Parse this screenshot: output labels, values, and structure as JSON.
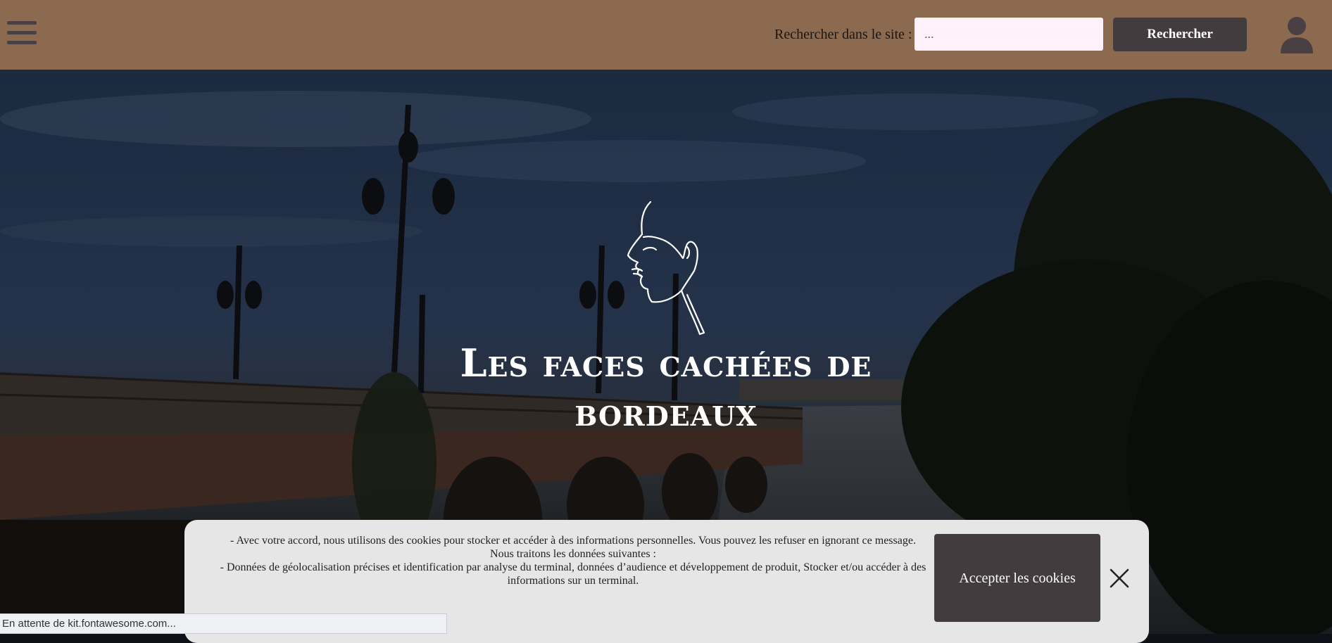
{
  "header": {
    "menu_icon": "hamburger-icon",
    "search_label": "Rechercher dans le site :",
    "search_placeholder": "...",
    "search_button": "Rechercher",
    "user_icon": "user-icon",
    "background_color": "#8b6a4f"
  },
  "hero": {
    "logo_icon": "face-line-art-icon",
    "title_line1": "Les faces cachées de",
    "title_line2": "bordeaux"
  },
  "cookie_banner": {
    "line1": "- Avec votre accord, nous utilisons des cookies pour stocker et accéder à des informations personnelles. Vous pouvez les refuser en ignorant ce message.",
    "line2": "Nous traitons les données suivantes :",
    "line3": "- Données de géolocalisation précises et identification par analyse du terminal, données d’audience et développement de produit, Stocker et/ou accéder à des",
    "line4": "informations sur un terminal.",
    "accept_button": "Accepter les cookies",
    "close_icon": "close-icon"
  },
  "status_bar": {
    "text": "En attente de kit.fontawesome.com..."
  },
  "colors": {
    "button_dark": "#433c3e",
    "search_field": "#fff2fa",
    "banner": "#e6e6e6"
  }
}
